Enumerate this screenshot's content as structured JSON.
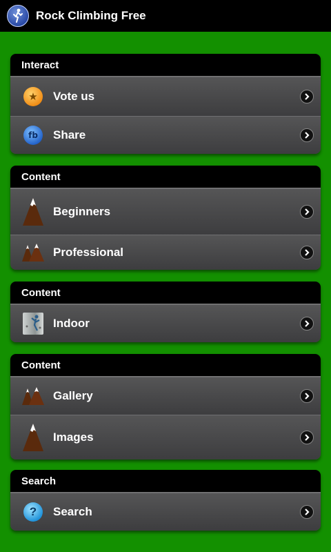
{
  "app": {
    "title": "Rock Climbing Free",
    "icon": "climber-icon"
  },
  "sections": [
    {
      "header": "Interact",
      "items": [
        {
          "label": "Vote us",
          "icon": "star-icon"
        },
        {
          "label": "Share",
          "icon": "facebook-icon"
        }
      ]
    },
    {
      "header": "Content",
      "items": [
        {
          "label": "Beginners",
          "icon": "mountain-icon"
        },
        {
          "label": "Professional",
          "icon": "mountains-icon"
        }
      ]
    },
    {
      "header": "Content",
      "items": [
        {
          "label": "Indoor",
          "icon": "climbing-wall-icon"
        }
      ]
    },
    {
      "header": "Content",
      "items": [
        {
          "label": "Gallery",
          "icon": "mountains-icon"
        },
        {
          "label": "Images",
          "icon": "mountain-icon"
        }
      ]
    },
    {
      "header": "Search",
      "items": [
        {
          "label": "Search",
          "icon": "question-icon"
        }
      ]
    }
  ],
  "colors": {
    "background": "#139000",
    "header": "#000000",
    "row": "#4a4a4c"
  }
}
